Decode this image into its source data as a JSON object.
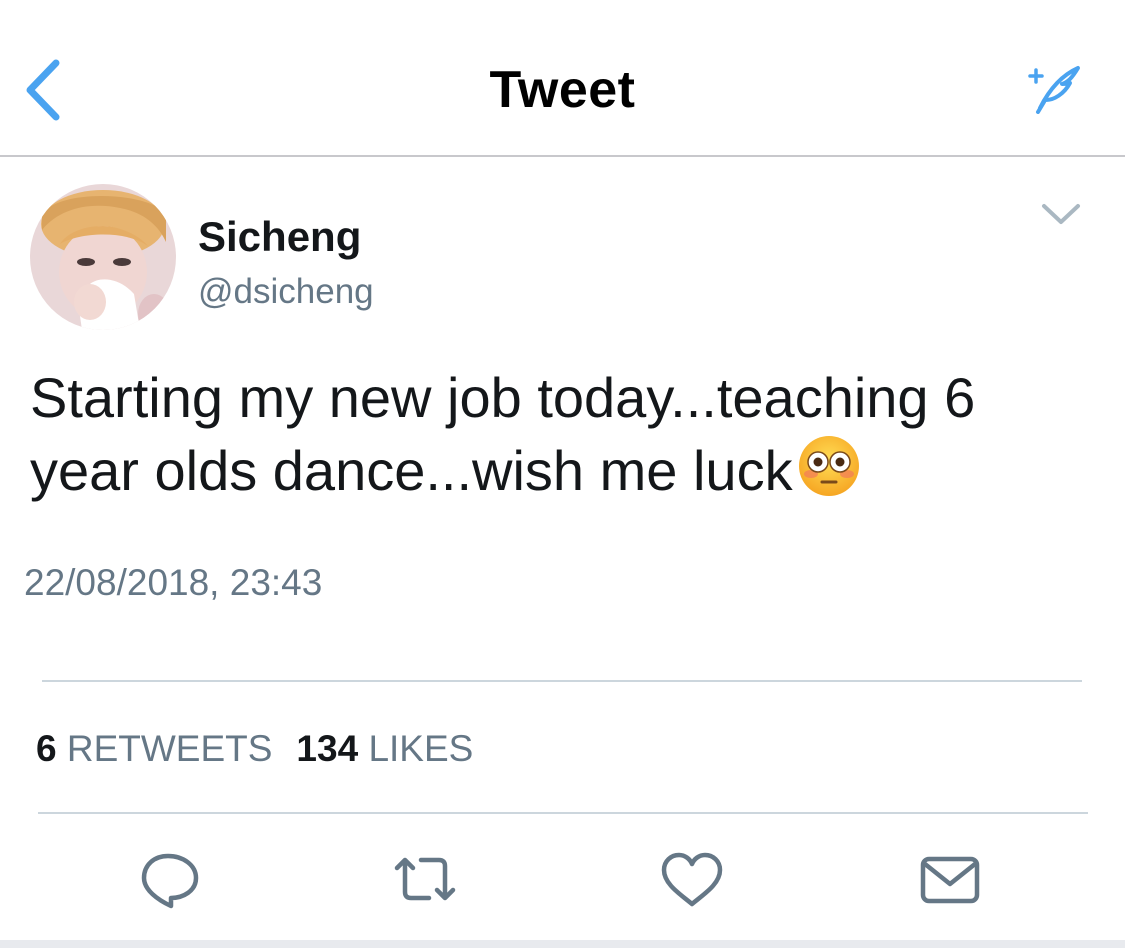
{
  "header": {
    "title": "Tweet",
    "back_icon": "chevron-left-icon",
    "compose_icon": "compose-feather-icon",
    "accent_color": "#4aa3f0"
  },
  "tweet": {
    "author": {
      "name": "Sicheng",
      "handle": "@dsicheng",
      "avatar_icon": "avatar"
    },
    "text_line1": "Starting my new job today...teaching 6",
    "text_line2": "year olds dance...wish me luck",
    "emoji": "flushed-face-emoji",
    "timestamp": "22/08/2018, 23:43",
    "stats": {
      "retweets_count": "6",
      "retweets_label": "RETWEETS",
      "likes_count": "134",
      "likes_label": "LIKES"
    },
    "actions": [
      {
        "name": "reply",
        "icon": "reply-icon"
      },
      {
        "name": "retweet",
        "icon": "retweet-icon"
      },
      {
        "name": "like",
        "icon": "heart-icon"
      },
      {
        "name": "direct-message",
        "icon": "envelope-icon"
      }
    ]
  },
  "colors": {
    "text_primary": "#14171a",
    "text_secondary": "#657786",
    "divider": "#ccd6dd",
    "icon_gray": "#657786"
  }
}
